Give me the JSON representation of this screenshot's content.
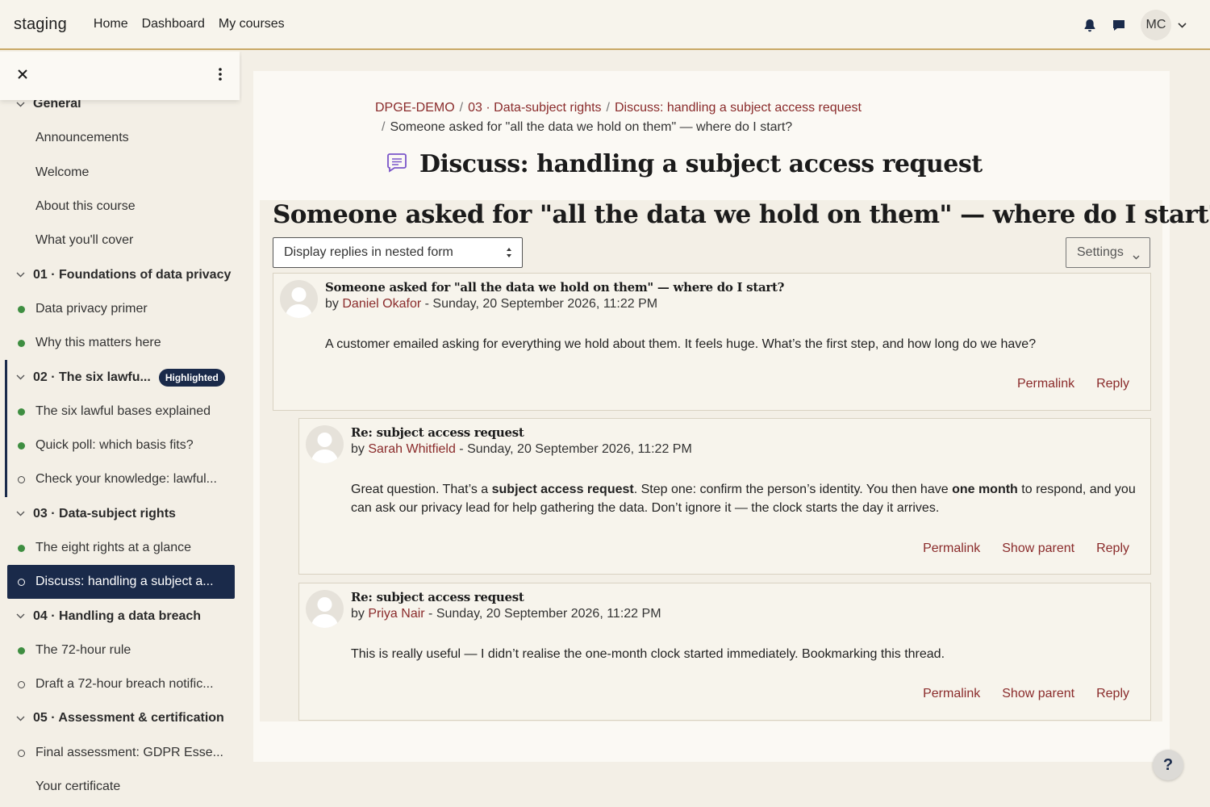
{
  "header": {
    "brand": "staging",
    "nav": [
      "Home",
      "Dashboard",
      "My courses"
    ],
    "user_initials": "MC"
  },
  "drawer": {
    "items": [
      {
        "type": "section",
        "label": "General"
      },
      {
        "type": "item",
        "label": "Announcements",
        "status": "none"
      },
      {
        "type": "item",
        "label": "Welcome",
        "status": "none"
      },
      {
        "type": "item",
        "label": "About this course",
        "status": "none"
      },
      {
        "type": "item",
        "label": "What you'll cover",
        "status": "none"
      },
      {
        "type": "section",
        "label": "01 · Foundations of data privacy"
      },
      {
        "type": "item",
        "label": "Data privacy primer",
        "status": "done"
      },
      {
        "type": "item",
        "label": "Why this matters here",
        "status": "done"
      },
      {
        "type": "section",
        "label": "02 · The six lawfu...",
        "badge": "Highlighted"
      },
      {
        "type": "item",
        "label": "The six lawful bases explained",
        "status": "done"
      },
      {
        "type": "item",
        "label": "Quick poll: which basis fits?",
        "status": "done"
      },
      {
        "type": "item",
        "label": "Check your knowledge: lawful...",
        "status": "todo"
      },
      {
        "type": "section",
        "label": "03 · Data-subject rights"
      },
      {
        "type": "item",
        "label": "The eight rights at a glance",
        "status": "done"
      },
      {
        "type": "item",
        "label": "Discuss: handling a subject a...",
        "status": "todo",
        "active": true
      },
      {
        "type": "section",
        "label": "04 · Handling a data breach"
      },
      {
        "type": "item",
        "label": "The 72-hour rule",
        "status": "done"
      },
      {
        "type": "item",
        "label": "Draft a 72-hour breach notific...",
        "status": "todo"
      },
      {
        "type": "section",
        "label": "05 · Assessment & certification"
      },
      {
        "type": "item",
        "label": "Final assessment: GDPR Esse...",
        "status": "todo"
      },
      {
        "type": "item",
        "label": "Your certificate",
        "status": "none"
      }
    ]
  },
  "breadcrumb": {
    "items": [
      "DPGE-DEMO",
      "03 · Data-subject rights",
      "Discuss: handling a subject access request"
    ],
    "current": "Someone asked for \"all the data we hold on them\" — where do I start?"
  },
  "page_title": "Discuss: handling a subject access request",
  "discussion": {
    "title": "Someone asked for \"all the data we hold on them\" — where do I start?",
    "display_mode": "Display replies in nested form",
    "settings_label": "Settings",
    "posts": [
      {
        "title": "Someone asked for \"all the data we hold on them\" — where do I start?",
        "by": "by",
        "author": "Daniel Okafor",
        "date": " - Sunday, 20 September 2026, 11:22 PM",
        "body": "A customer emailed asking for everything we hold about them. It feels huge. What’s the first step, and how long do we have?",
        "actions": [
          "Permalink",
          "Reply"
        ]
      },
      {
        "title": "Re: subject access request",
        "by": "by",
        "author": "Sarah Whitfield",
        "date": " - Sunday, 20 September 2026, 11:22 PM",
        "body_parts": [
          "Great question. That’s a ",
          "subject access request",
          ". Step one: confirm the person’s identity. You then have ",
          "one month",
          " to respond, and you can ask our privacy lead for help gathering the data. Don’t ignore it — the clock starts the day it arrives."
        ],
        "actions": [
          "Permalink",
          "Show parent",
          "Reply"
        ]
      },
      {
        "title": "Re: subject access request",
        "by": "by",
        "author": "Priya Nair",
        "date": " - Sunday, 20 September 2026, 11:22 PM",
        "body": "This is really useful — I didn’t realise the one-month clock started immediately. Bookmarking this thread.",
        "actions": [
          "Permalink",
          "Show parent",
          "Reply"
        ]
      }
    ]
  },
  "help_label": "?",
  "colors": {
    "accent": "#8a2b2b",
    "navy": "#1a2a4a",
    "complete": "#3e8e41",
    "gold": "#c9a866"
  }
}
